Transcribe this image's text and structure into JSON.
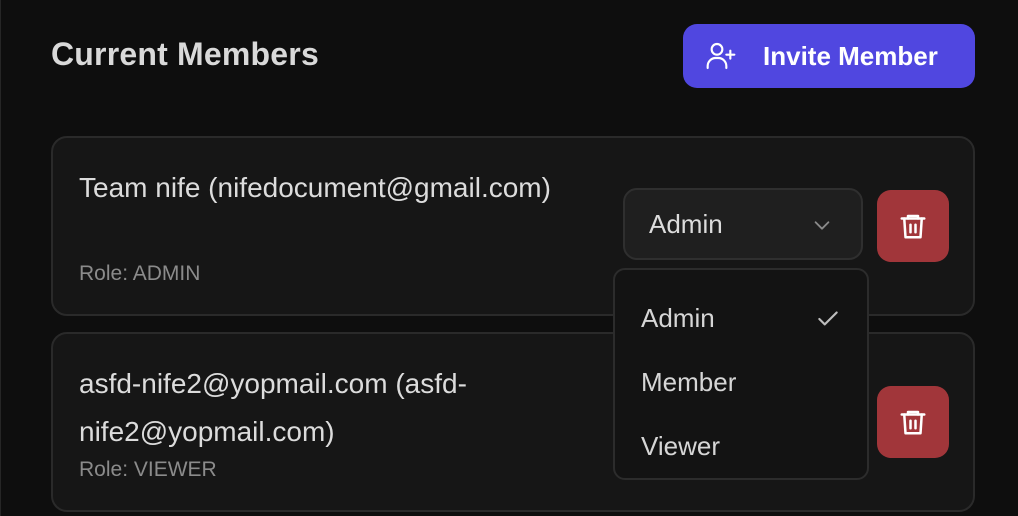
{
  "section": {
    "title": "Current Members",
    "invite_label": "Invite Member"
  },
  "members": [
    {
      "name": "Team nife (nifedocument@gmail.com)",
      "role": "Role: ADMIN",
      "selected_role": "Admin"
    },
    {
      "name": "asfd-nife2@yopmail.com (asfd-nife2@yopmail.com)",
      "role": "Role: VIEWER",
      "selected_role": "Viewer"
    }
  ],
  "role_dropdown": {
    "open": true,
    "options": [
      "Admin",
      "Member",
      "Viewer"
    ],
    "checked": "Admin"
  },
  "colors": {
    "accent": "#5047e0",
    "danger": "#a1363a",
    "background": "#0e0e0e",
    "card": "#161616"
  },
  "icons": {
    "invite": "user-plus-icon",
    "delete": "trash-icon",
    "select": "chevron-down-icon",
    "selected": "check-icon"
  }
}
